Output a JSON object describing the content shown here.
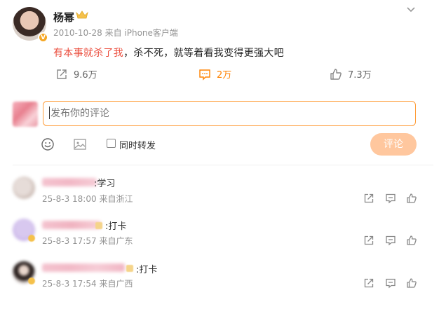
{
  "post": {
    "username": "杨幂",
    "timestamp": "2010-10-28",
    "source": "来自 iPhone客户端",
    "text_highlight": "有本事就杀了我",
    "text_rest": "，杀不死，就等着看我变得更强大吧",
    "verified_badge": "V",
    "share_count": "9.6万",
    "comment_count": "2万",
    "like_count": "7.3万"
  },
  "composer": {
    "placeholder": "发布你的评论",
    "repost_label": "同时转发",
    "submit_label": "评论"
  },
  "comments": [
    {
      "text": ":学习",
      "time": "25-8-3 18:00",
      "location": "来自浙江"
    },
    {
      "text": ":打卡",
      "time": "25-8-3 17:57",
      "location": "来自广东"
    },
    {
      "text": ":打卡",
      "time": "25-8-3 17:54",
      "location": "来自广西"
    }
  ],
  "colors": {
    "accent": "#ff8200",
    "highlight_text": "#eb4d3d",
    "submit_bg": "#ffc79e",
    "meta_gray": "#939393"
  },
  "icons": [
    "chevron-down-icon",
    "crown-icon",
    "share-icon",
    "comment-icon",
    "like-icon",
    "emoji-icon",
    "image-icon",
    "reply-icon"
  ]
}
